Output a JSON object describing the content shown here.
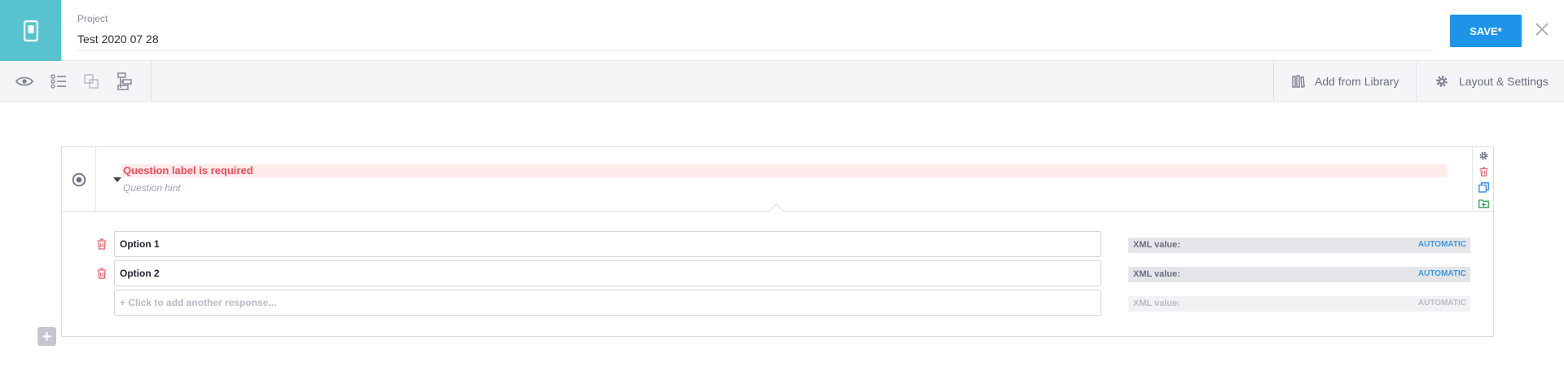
{
  "header": {
    "project_label": "Project",
    "project_name": "Test 2020 07 28",
    "save_label": "SAVE*"
  },
  "toolbar": {
    "icons": [
      "eye-icon",
      "list-icon",
      "copy-icon",
      "tree-icon"
    ],
    "add_library_label": "Add from Library",
    "layout_settings_label": "Layout & Settings"
  },
  "question": {
    "label_error": "Question label is required",
    "hint_placeholder": "Question hint",
    "options": [
      {
        "label": "Option 1",
        "xml_label": "XML value:",
        "xml_value": "AUTOMATIC"
      },
      {
        "label": "Option 2",
        "xml_label": "XML value:",
        "xml_value": "AUTOMATIC"
      }
    ],
    "add_response": {
      "placeholder": "+ Click to add another response...",
      "xml_label": "XML value:",
      "xml_value": "AUTOMATIC"
    }
  },
  "colors": {
    "accent": "#1e94e8",
    "logo_tile": "#58c3cf",
    "error": "#ef4b5a",
    "error_bg": "#fdebec"
  }
}
